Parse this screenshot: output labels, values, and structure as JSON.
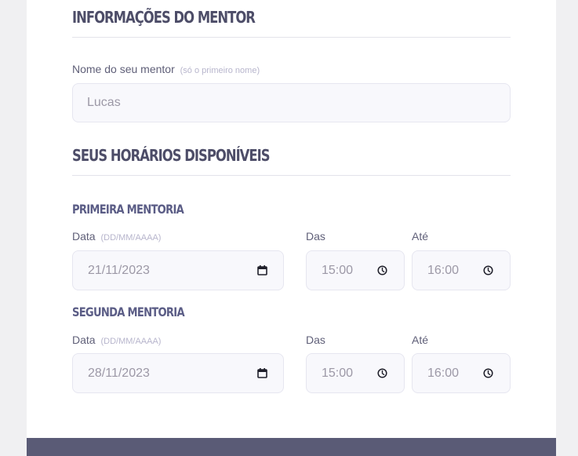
{
  "mentor_section": {
    "title": "INFORMAÇÕES DO MENTOR",
    "name_label": "Nome do seu mentor",
    "name_hint": "(só o primeiro nome)",
    "name_value": "Lucas"
  },
  "schedule_section": {
    "title": "SEUS HORÁRIOS DISPONÍVEIS",
    "sessions": [
      {
        "title": "PRIMEIRA MENTORIA",
        "date_label": "Data",
        "date_hint": "(DD/MM/AAAA)",
        "date_value": "21/11/2023",
        "from_label": "Das",
        "from_value": "15:00",
        "to_label": "Até",
        "to_value": "16:00"
      },
      {
        "title": "SEGUNDA MENTORIA",
        "date_label": "Data",
        "date_hint": "(DD/MM/AAAA)",
        "date_value": "28/11/2023",
        "from_label": "Das",
        "from_value": "15:00",
        "to_label": "Até",
        "to_value": "16:00"
      }
    ]
  },
  "icons": {
    "date_picker": "calendar-icon",
    "time_picker": "clock-icon"
  },
  "colors": {
    "section_title": "#4d4d68",
    "subsection_title": "#5b5d86",
    "label": "#5f5f78",
    "hint": "#b7b5cc",
    "field_bg": "#f8f8fc",
    "field_border": "#e6e6f0",
    "field_text": "#9c98a6",
    "footer": "#5a5b76"
  }
}
